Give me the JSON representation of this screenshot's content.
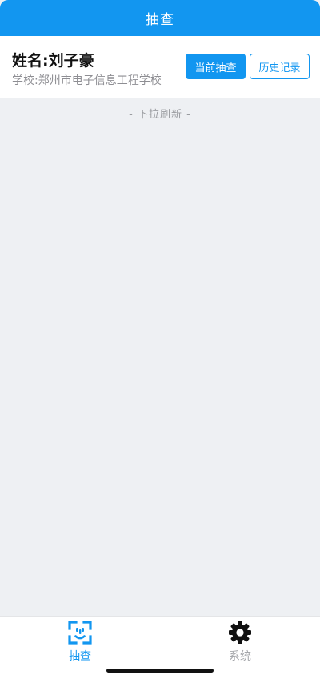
{
  "header": {
    "title": "抽查"
  },
  "student": {
    "name": "姓名:刘子豪",
    "school": "学校:郑州市电子信息工程学校"
  },
  "actions": {
    "current_check_label": "当前抽查",
    "history_label": "历史记录"
  },
  "content": {
    "refresh_hint": "- 下拉刷新 -"
  },
  "tabbar": {
    "items": [
      {
        "label": "抽查",
        "icon": "face-scan-icon",
        "active": true
      },
      {
        "label": "系统",
        "icon": "gear-icon",
        "active": false
      }
    ]
  },
  "colors": {
    "primary": "#1296f0",
    "background": "#eef0f3",
    "inactive": "#a4a6aa",
    "muted_text": "#8e8e93"
  }
}
